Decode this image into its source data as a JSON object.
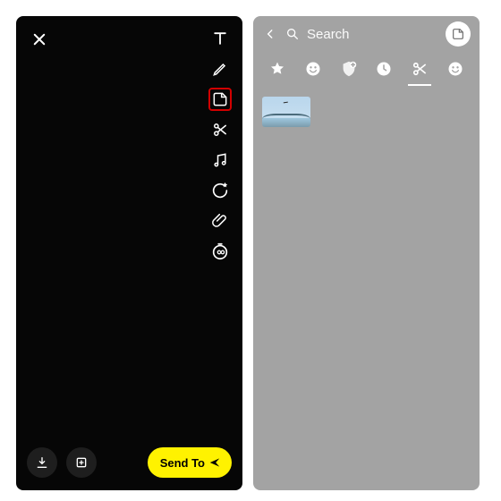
{
  "left_panel": {
    "tools": [
      {
        "name": "text",
        "label": "Text"
      },
      {
        "name": "pencil",
        "label": "Draw"
      },
      {
        "name": "sticker",
        "label": "Stickers",
        "highlighted": true
      },
      {
        "name": "scissors",
        "label": "Cut"
      },
      {
        "name": "music",
        "label": "Music"
      },
      {
        "name": "loop",
        "label": "Remix"
      },
      {
        "name": "attachment",
        "label": "Link"
      },
      {
        "name": "timer",
        "label": "Timer"
      }
    ],
    "send_label": "Send To"
  },
  "right_panel": {
    "search_placeholder": "Search",
    "tabs": [
      {
        "name": "star",
        "label": "Favorites"
      },
      {
        "name": "emoji",
        "label": "Emoji"
      },
      {
        "name": "shield-plus",
        "label": "Cameo"
      },
      {
        "name": "recent",
        "label": "Recent"
      },
      {
        "name": "scissors",
        "label": "Cutouts",
        "active": true
      },
      {
        "name": "smiley",
        "label": "Bitmoji"
      }
    ],
    "sticker_count": 1
  }
}
